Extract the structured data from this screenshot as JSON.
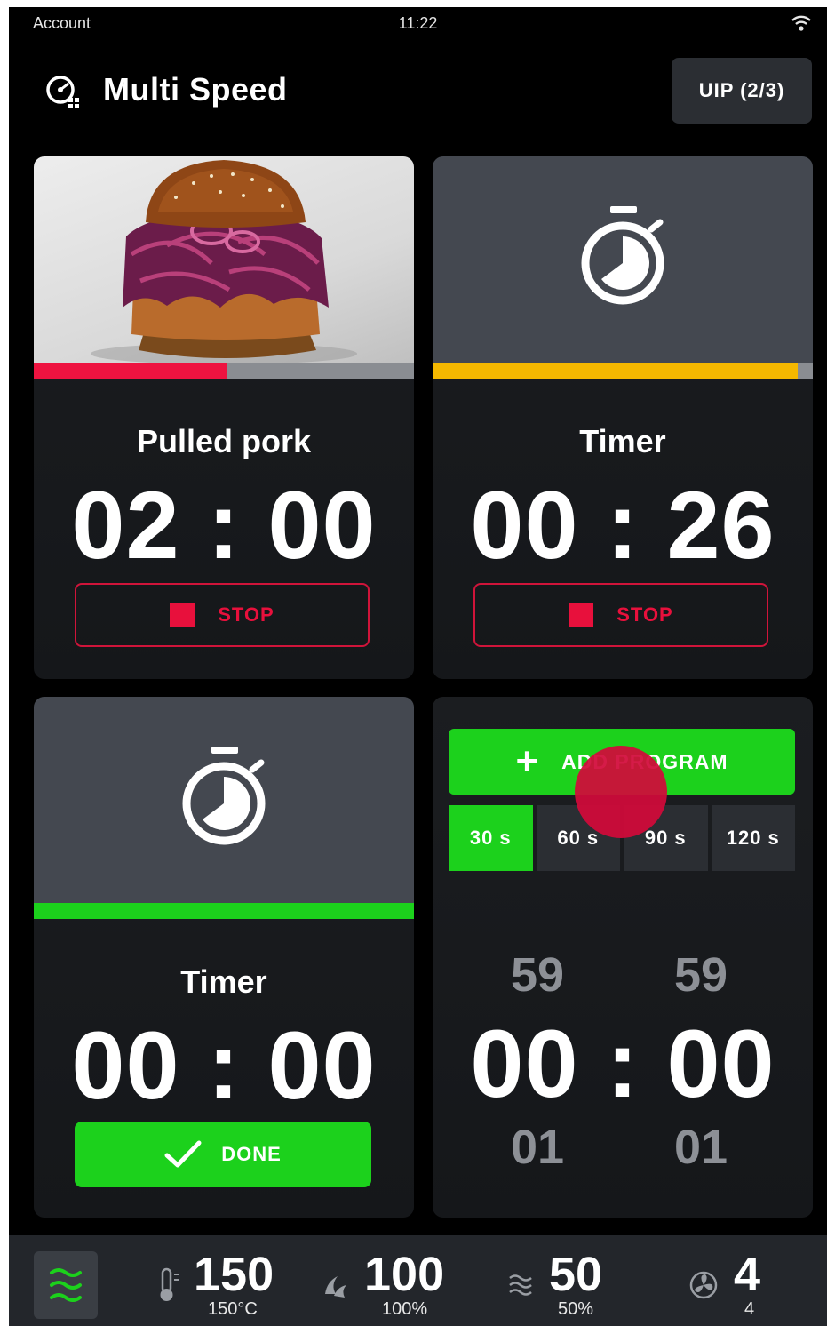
{
  "status_bar": {
    "account": "Account",
    "time": "11:22"
  },
  "header": {
    "title": "Multi Speed",
    "uip_label": "UIP (2/3)"
  },
  "cards": [
    {
      "label": "Pulled pork",
      "time": "02 : 00",
      "button": "STOP",
      "progress": 0.51,
      "progress_color": "#ee1340"
    },
    {
      "label": "Timer",
      "time": "00 : 26",
      "button": "STOP",
      "progress": 0.96,
      "progress_color": "#f5b800"
    },
    {
      "label": "Timer",
      "time": "00 : 00",
      "button": "DONE",
      "progress": 1.0,
      "progress_color": "#1cd11c"
    }
  ],
  "add_program": {
    "label": "ADD PROGRAM",
    "presets": [
      "30 s",
      "60 s",
      "90 s",
      "120 s"
    ],
    "selected_preset": "30 s",
    "picker": {
      "above_min": "59",
      "above_sec": "59",
      "time": "00 : 00",
      "below_min": "01",
      "below_sec": "01"
    }
  },
  "bottom_bar": {
    "temperature": {
      "value": "150",
      "unit": "150°C"
    },
    "steam": {
      "value": "100",
      "unit": "100%"
    },
    "humidity": {
      "value": "50",
      "unit": "50%"
    },
    "fan": {
      "value": "4",
      "unit": "4"
    }
  },
  "colors": {
    "accent_green": "#1cd11c",
    "stop_red": "#e8103c",
    "background": "#000000"
  },
  "icons": [
    "wifi-icon",
    "multi-speed-icon",
    "stopwatch-icon",
    "stop-icon",
    "check-icon",
    "plus-icon",
    "wave-mode-icon",
    "thermometer-icon",
    "steam-icon",
    "humidity-icon",
    "fan-icon"
  ]
}
